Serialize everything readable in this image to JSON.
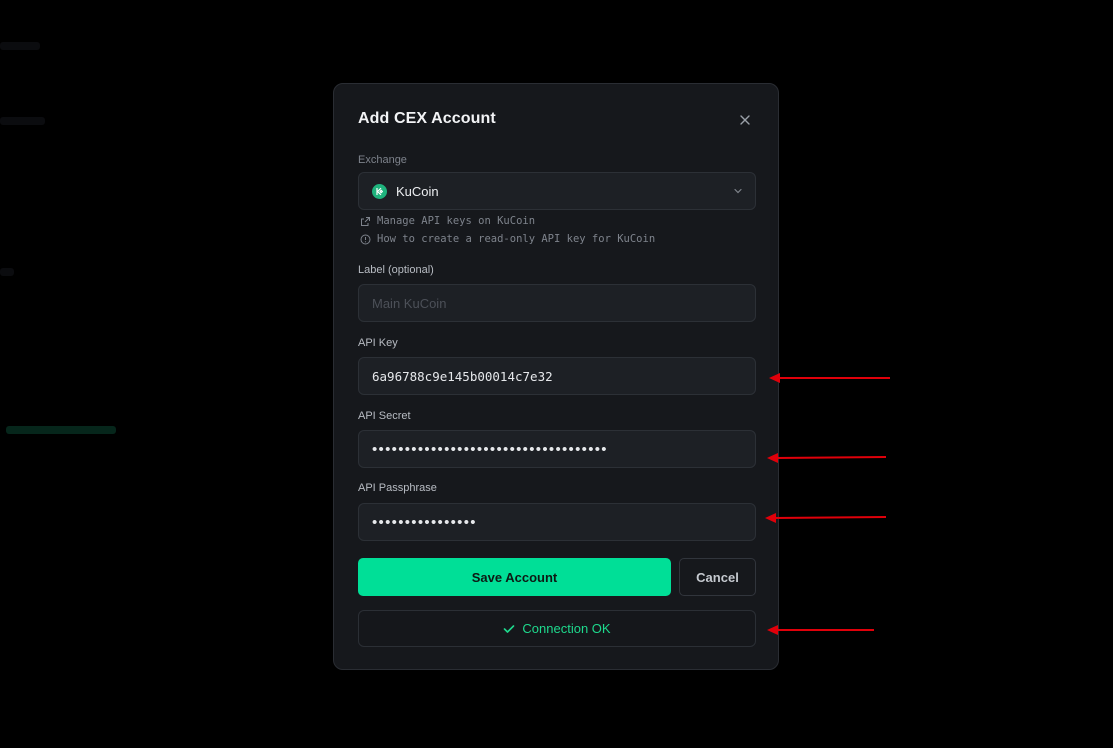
{
  "modal": {
    "title": "Add CEX Account",
    "close_icon": "close-icon"
  },
  "exchange": {
    "label": "Exchange",
    "selected": "KuCoin",
    "logo_icon": "kucoin-logo-icon",
    "logo_color": "#1fb37d"
  },
  "links": {
    "manage": "Manage API keys on KuCoin",
    "howto": "How to create a read-only API key for KuCoin"
  },
  "label_field": {
    "label": "Label (optional)",
    "placeholder": "Main KuCoin",
    "value": ""
  },
  "api_key": {
    "label": "API Key",
    "value": "6a96788c9e145b00014c7e32"
  },
  "api_secret": {
    "label": "API Secret",
    "value": "••••••••••••••••••••••••••••••••••••"
  },
  "api_passphrase": {
    "label": "API Passphrase",
    "value": "••••••••••••••••"
  },
  "actions": {
    "save": "Save Account",
    "cancel": "Cancel"
  },
  "status": {
    "text": "Connection OK",
    "icon": "check-icon",
    "color": "#1ed98d"
  },
  "colors": {
    "accent": "#00df97",
    "annotation_arrow": "#e0000a"
  }
}
